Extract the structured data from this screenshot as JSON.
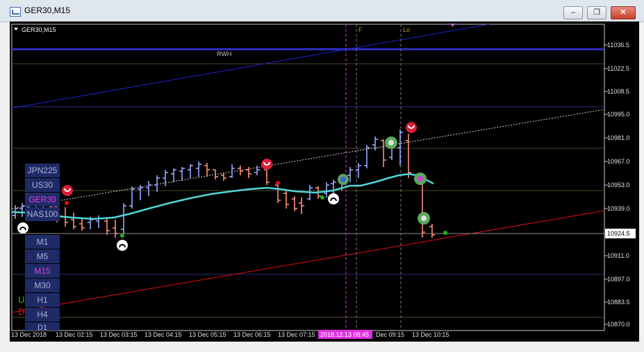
{
  "window": {
    "title": "GER30,M15",
    "minimize_label": "–",
    "restore_label": "❐",
    "close_label": "✕"
  },
  "chart": {
    "header": "GER30,M15",
    "line_label": "RWH",
    "marker_f": "F",
    "marker_lo": "Lo",
    "current_price": "10924.5",
    "price_scale": [
      "11036.5",
      "11022.5",
      "11008.5",
      "10995.0",
      "10981.0",
      "10967.0",
      "10953.0",
      "10939.0",
      "10924.5",
      "10911.0",
      "10897.0",
      "10883.5",
      "10870.0"
    ],
    "time_labels": [
      "13 Dec 2018",
      "13 Dec 02:15",
      "13 Dec 03:15",
      "13 Dec 04:15",
      "13 Dec 05:15",
      "13 Dec 06:15",
      "13 Dec 07:15",
      "2018.12.13 08:45",
      "Dec 09:15",
      "13 Dec 10:15"
    ],
    "symbols": [
      "JPN225",
      "US30",
      "GER30",
      "NAS100"
    ],
    "active_symbol": "GER30",
    "timeframes": [
      "M1",
      "M5",
      "M15",
      "M30",
      "H1",
      "H4",
      "D1"
    ],
    "active_timeframe": "M15",
    "up_letter": "U",
    "down_letter": "D",
    "colors": {
      "background": "#000000",
      "bull_bar": "#9aa6ff",
      "bear_bar": "#ff8f78",
      "moving_average": "#4ed6d8",
      "blue_trendline": "#2020d8",
      "red_trendline": "#e01010",
      "rwh_line": "#3030c8",
      "selected_time": "#e030e0"
    }
  }
}
